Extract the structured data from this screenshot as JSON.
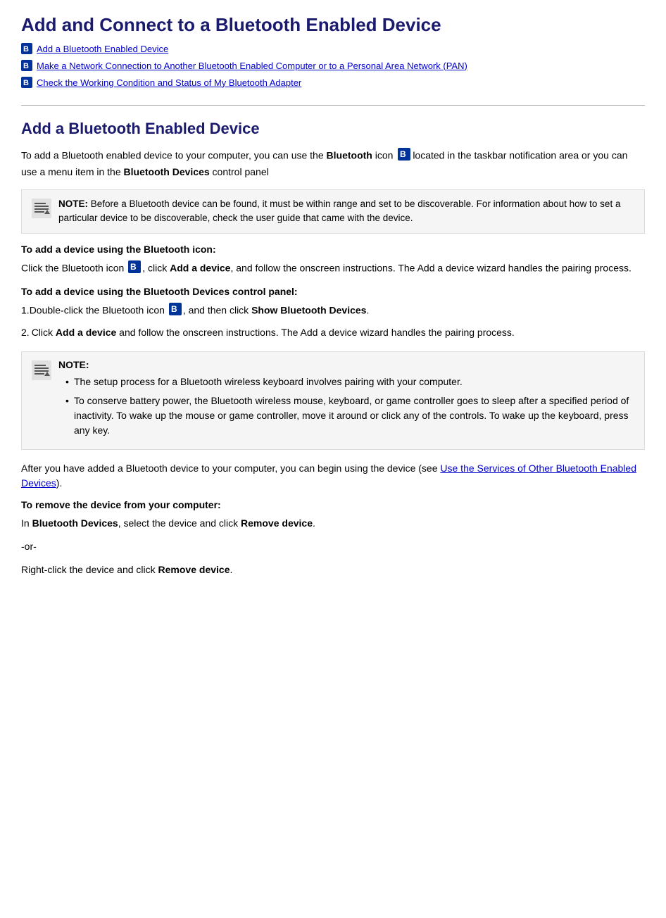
{
  "page": {
    "title": "Add and Connect to a Bluetooth Enabled Device",
    "toc": {
      "items": [
        {
          "label": "Add a Bluetooth Enabled Device",
          "id": "add-bt-link"
        },
        {
          "label": "Make a Network Connection to Another Bluetooth Enabled Computer or to a Personal Area Network (PAN)",
          "id": "network-link"
        },
        {
          "label": "Check the Working Condition and Status of My Bluetooth Adapter",
          "id": "check-link"
        }
      ]
    },
    "section1": {
      "title": "Add a Bluetooth Enabled Device",
      "intro": "To add a Bluetooth enabled device to your computer, you can use the ",
      "intro_bold": "Bluetooth",
      "intro_mid": " icon ",
      "intro_end": "located in the taskbar notification area or you can use a menu item in the ",
      "intro_bold2": "Bluetooth Devices",
      "intro_end2": " control panel",
      "note1": {
        "label": "NOTE:",
        "text": " Before a Bluetooth device can be found, it must be within range and set to be discoverable. For information about how to set a particular device to be discoverable, check the user guide that came with the device."
      },
      "subheading1": "To add a device using the Bluetooth icon:",
      "step1_text1": "Click the Bluetooth icon ",
      "step1_text2": ", click ",
      "step1_bold": "Add a device",
      "step1_text3": ", and follow the onscreen instructions. The Add a device wizard handles the pairing process.",
      "subheading2": "To add a device using the Bluetooth Devices control panel:",
      "step2a_num": "1.",
      "step2a_text1": "Double-click the Bluetooth icon ",
      "step2a_text2": ", and then click ",
      "step2a_bold": "Show Bluetooth Devices",
      "step2a_text3": ".",
      "step2b_num": "2.",
      "step2b_text1": "Click ",
      "step2b_bold": "Add a device",
      "step2b_text2": " and follow the onscreen instructions. The Add a device wizard handles the pairing process.",
      "note2": {
        "label": "NOTE:",
        "bullets": [
          {
            "prefix": "",
            "text": "The setup process for a Bluetooth wireless keyboard involves pairing with your computer."
          },
          {
            "prefix": "To conserve battery power, the Bluetooth wireless mouse, keyboard, or game controller goes to sleep after a specified period of inactivity. To wake up the mouse or game controller, move it around or click any of the controls. To wake up the keyboard, press any key.",
            "text": ""
          }
        ]
      },
      "after_text1": "After you have added a Bluetooth device to your computer, you can begin using the device (see ",
      "after_link": "Use the Services of Other Bluetooth Enabled Devices",
      "after_text2": ").",
      "subheading3": "To remove the device from your computer:",
      "remove_text1": "In ",
      "remove_bold": "Bluetooth Devices",
      "remove_text2": ", select the device and click ",
      "remove_bold2": "Remove device",
      "remove_text3": ".",
      "or_text": "-or-",
      "right_click_text1": "Right-click the device and click ",
      "right_click_bold": "Remove device",
      "right_click_text2": "."
    }
  }
}
